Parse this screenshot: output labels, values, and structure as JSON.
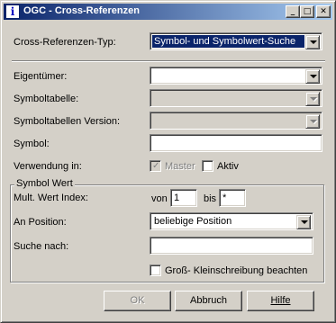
{
  "window": {
    "title": "OGC - Cross-Referenzen",
    "title_icon_glyph": "i",
    "controls": {
      "minimize": "_",
      "maximize": "□",
      "close": "✕"
    }
  },
  "crossref": {
    "type_label": "Cross-Referenzen-Typ:",
    "type_value": "Symbol- und Symbolwert-Suche"
  },
  "fields": {
    "eigentuemer_label": "Eigentümer:",
    "eigentuemer_value": "",
    "symboltabelle_label": "Symboltabelle:",
    "symboltabelle_value": "",
    "symboltabellen_version_label": "Symboltabellen Version:",
    "symboltabellen_version_value": "",
    "symbol_label": "Symbol:",
    "symbol_value": "",
    "verwendung_label": "Verwendung in:",
    "master_label": "Master",
    "master_checked": true,
    "aktiv_label": "Aktiv",
    "aktiv_checked": false
  },
  "symbol_wert": {
    "group_title": "Symbol Wert",
    "mult_index_label": "Mult. Wert Index:",
    "von_label": "von",
    "von_value": "1",
    "bis_label": "bis",
    "bis_value": "*",
    "an_position_label": "An Position:",
    "an_position_value": "beliebige Position",
    "suche_nach_label": "Suche nach:",
    "suche_nach_value": "",
    "case_label": "Groß- Kleinschreibung beachten",
    "case_checked": false
  },
  "buttons": {
    "ok": "OK",
    "abbruch": "Abbruch",
    "hilfe": "Hilfe"
  },
  "colors": {
    "dialog_bg": "#d4d0c8",
    "titlebar_start": "#0a246a",
    "titlebar_end": "#a6caf0",
    "selection": "#0a246a",
    "disabled_text": "#808080"
  }
}
